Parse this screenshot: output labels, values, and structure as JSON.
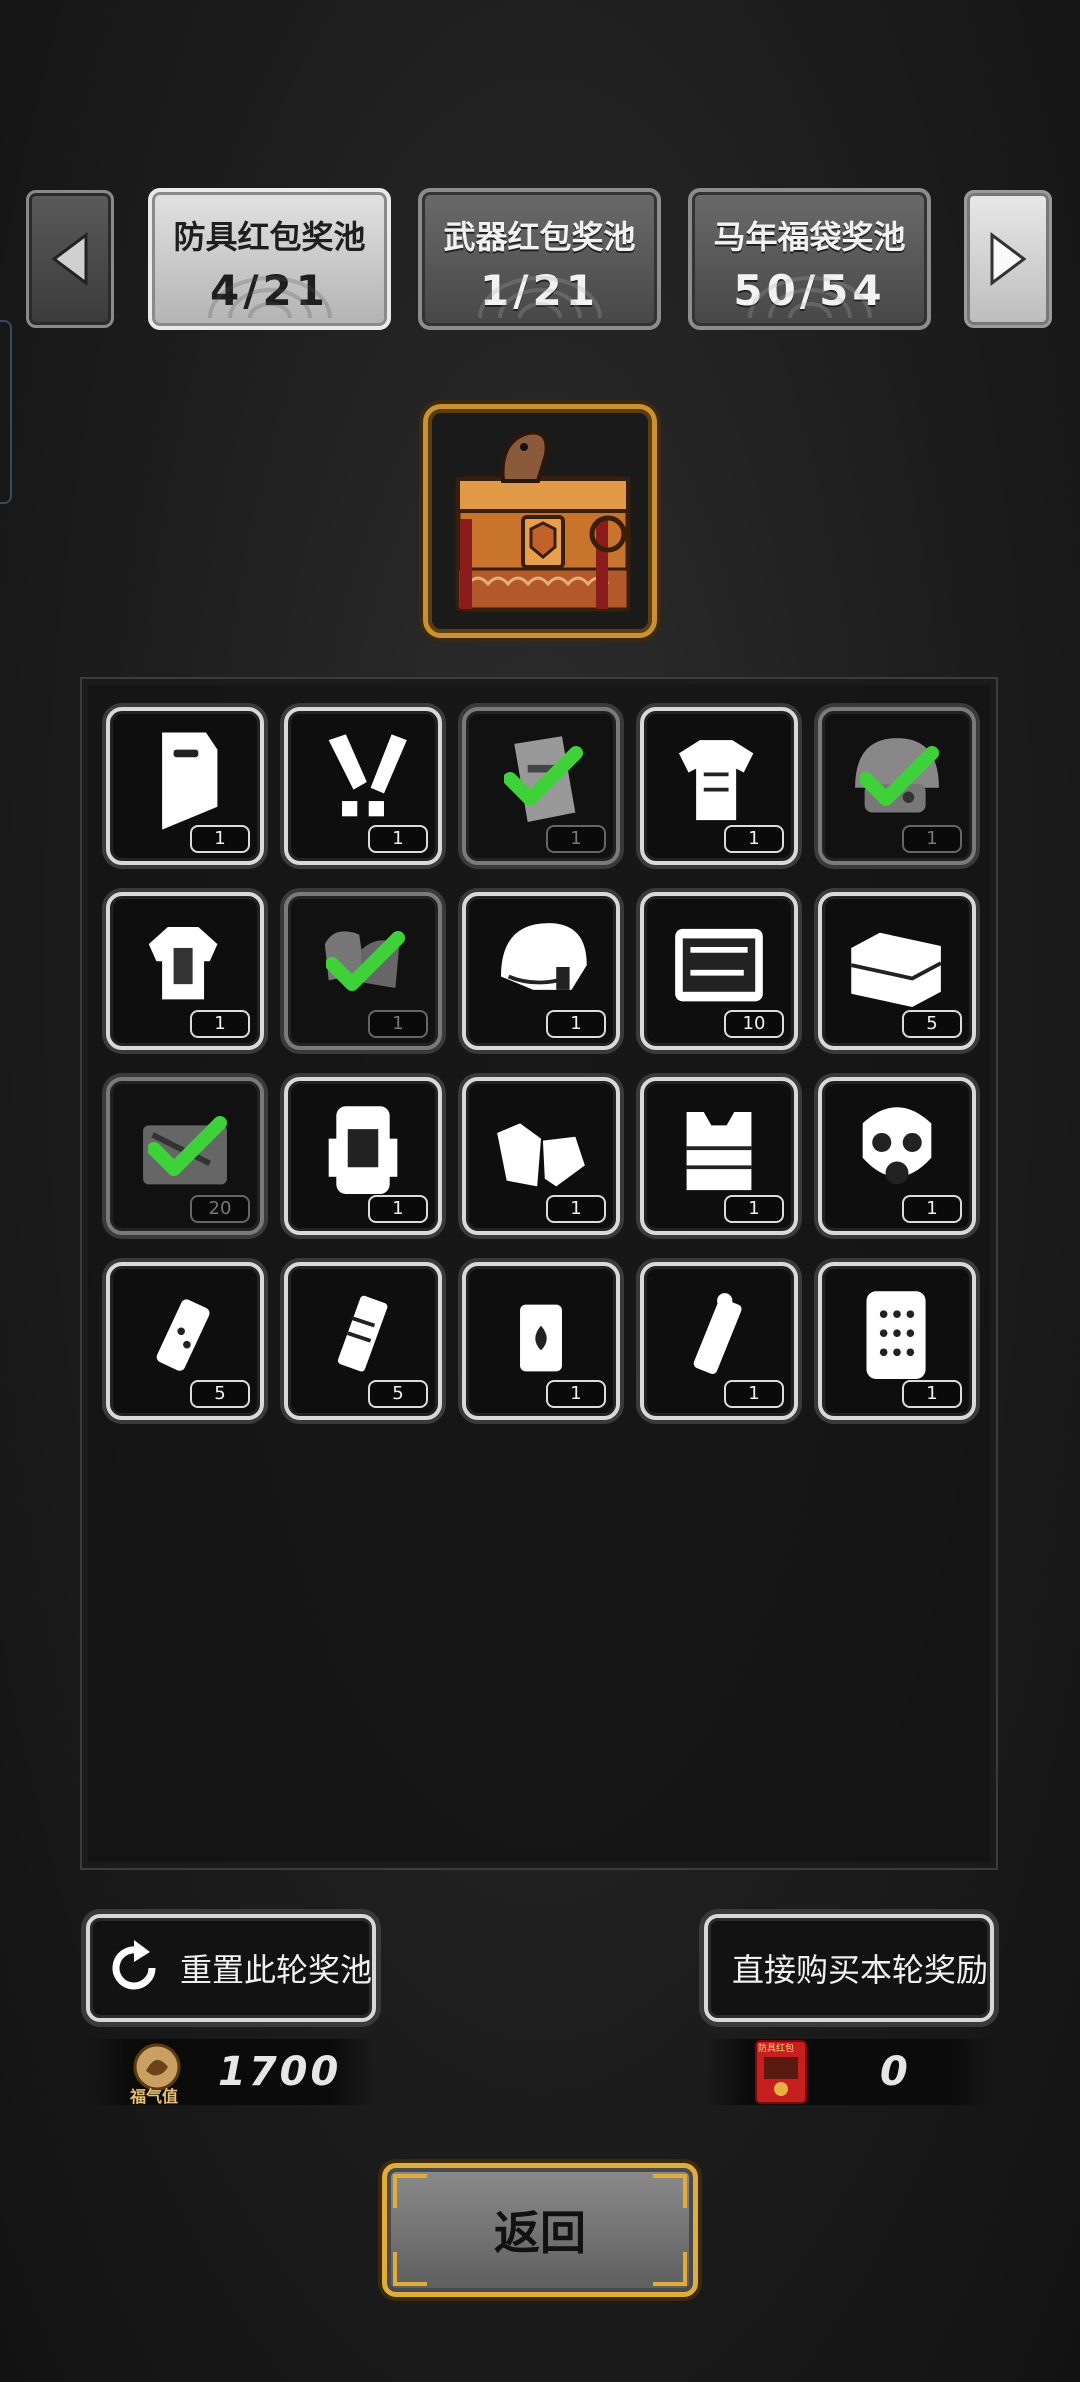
{
  "tabs": [
    {
      "label": "防具红包奖池",
      "progress": "4/21",
      "active": true
    },
    {
      "label": "武器红包奖池",
      "progress": "1/21",
      "active": false
    },
    {
      "label": "马年福袋奖池",
      "progress": "50/54",
      "active": false
    }
  ],
  "items": [
    {
      "icon": "riot-shield-icon",
      "qty": "1",
      "owned": false
    },
    {
      "icon": "leg-guards-icon",
      "qty": "1",
      "owned": false
    },
    {
      "icon": "armor-plate-icon",
      "qty": "1",
      "owned": true
    },
    {
      "icon": "torso-armor-icon",
      "qty": "1",
      "owned": false
    },
    {
      "icon": "tactical-helmet-icon",
      "qty": "1",
      "owned": true
    },
    {
      "icon": "bomb-suit-icon",
      "qty": "1",
      "owned": false
    },
    {
      "icon": "gloves-icon",
      "qty": "1",
      "owned": true
    },
    {
      "icon": "visor-helmet-icon",
      "qty": "1",
      "owned": false
    },
    {
      "icon": "tool-case-icon",
      "qty": "10",
      "owned": false
    },
    {
      "icon": "toolbox-icon",
      "qty": "5",
      "owned": false
    },
    {
      "icon": "repair-kit-icon",
      "qty": "20",
      "owned": true
    },
    {
      "icon": "backpack-icon",
      "qty": "1",
      "owned": false
    },
    {
      "icon": "tactical-gloves-icon",
      "qty": "1",
      "owned": false
    },
    {
      "icon": "vest-icon",
      "qty": "1",
      "owned": false
    },
    {
      "icon": "gas-mask-icon",
      "qty": "1",
      "owned": false
    },
    {
      "icon": "stun-grenade-icon",
      "qty": "5",
      "owned": false
    },
    {
      "icon": "flash-grenade-icon",
      "qty": "5",
      "owned": false
    },
    {
      "icon": "incendiary-grenade-icon",
      "qty": "1",
      "owned": false
    },
    {
      "icon": "smoke-grenade-icon",
      "qty": "1",
      "owned": false
    },
    {
      "icon": "ballistic-shield-icon",
      "qty": "1",
      "owned": false
    }
  ],
  "reset_button_label": "重置此轮奖池",
  "buy_button_label": "直接购买本轮奖励",
  "fortune_label": "福气值",
  "fortune_value": "1700",
  "redpacket_label": "防具红包",
  "redpacket_value": "0",
  "back_button_label": "返回",
  "colors": {
    "gold": "#e0ac3c",
    "check": "#3fd13a"
  }
}
